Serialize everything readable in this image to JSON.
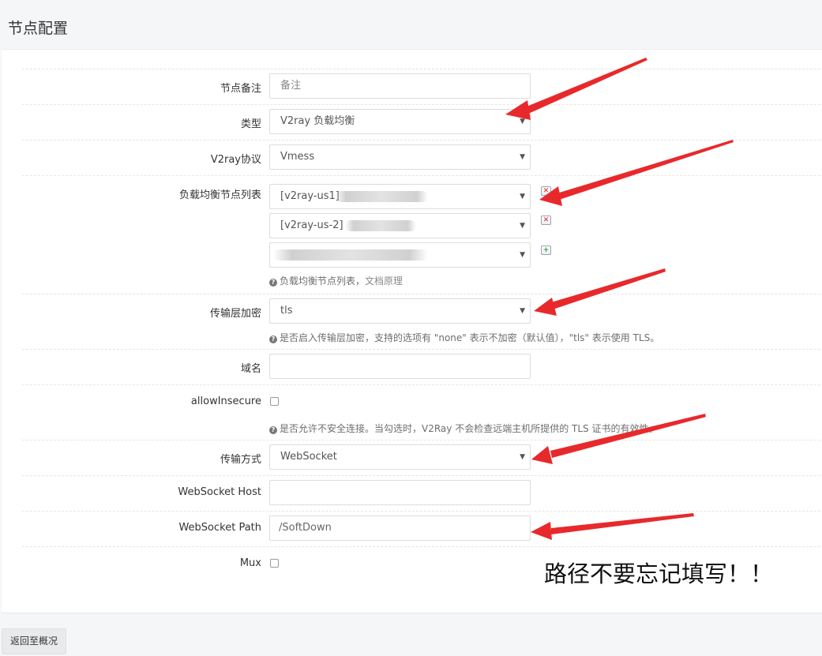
{
  "page": {
    "title": "节点配置"
  },
  "form": {
    "remark": {
      "label": "节点备注",
      "placeholder": "备注"
    },
    "type": {
      "label": "类型",
      "value": "V2ray 负载均衡"
    },
    "protocol": {
      "label": "V2ray协议",
      "value": "Vmess"
    },
    "balancer": {
      "label": "负载均衡节点列表",
      "items": [
        {
          "value": "[v2ray-us1]"
        },
        {
          "value": "[v2ray-us-2]"
        },
        {
          "value": ""
        }
      ],
      "help_text": "负载均衡节点列表，",
      "help_link": "文档原理"
    },
    "security": {
      "label": "传输层加密",
      "value": "tls",
      "help_text": "是否启入传输层加密，支持的选项有 \"none\" 表示不加密（默认值），\"tls\" 表示使用 TLS。"
    },
    "domain": {
      "label": "域名",
      "value": ""
    },
    "allow_insecure": {
      "label": "allowInsecure",
      "checked": false,
      "help_text": "是否允许不安全连接。当勾选时，V2Ray 不会检查远端主机所提供的 TLS 证书的有效性。"
    },
    "transport": {
      "label": "传输方式",
      "value": "WebSocket"
    },
    "ws_host": {
      "label": "WebSocket Host",
      "value": ""
    },
    "ws_path": {
      "label": "WebSocket Path",
      "value": "/SoftDown"
    },
    "mux": {
      "label": "Mux",
      "checked": false
    }
  },
  "annotation": {
    "text": "路径不要忘记填写！！",
    "arrow_color": "#e8292c"
  },
  "footer": {
    "back_label": "返回至概况"
  },
  "icons": {
    "caret": "▼",
    "help": "?",
    "delete": "✕",
    "add": "+"
  }
}
